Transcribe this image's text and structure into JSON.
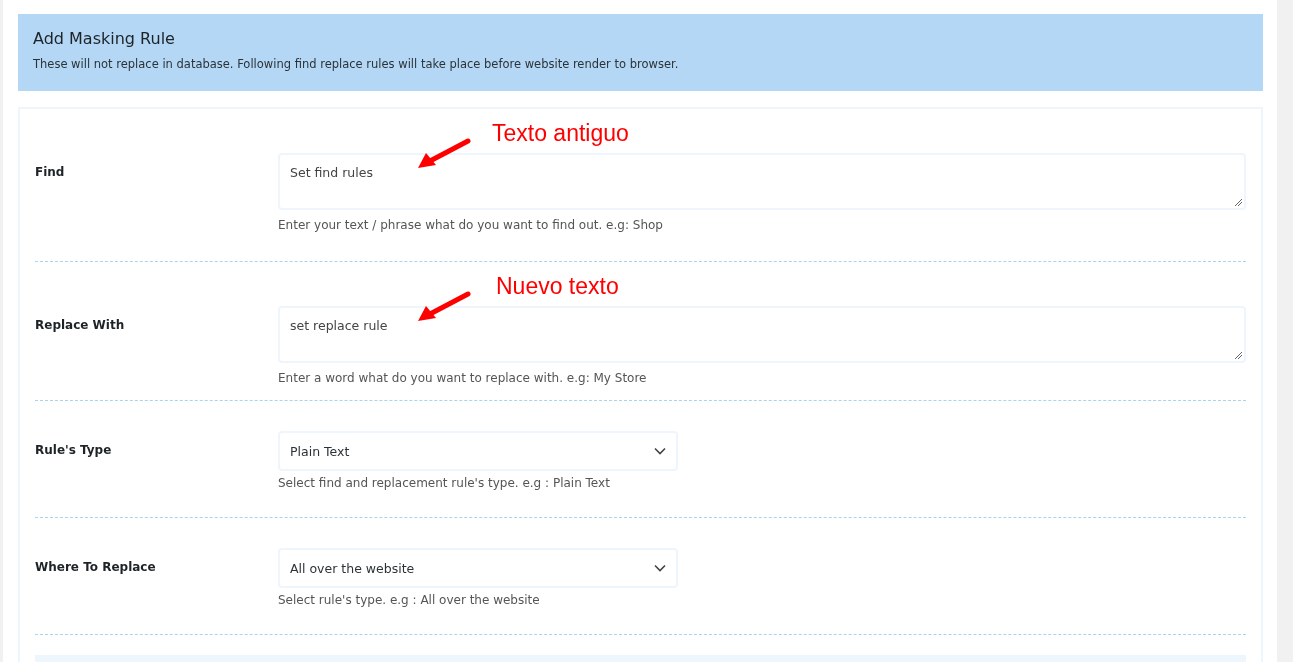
{
  "header": {
    "title": "Add Masking Rule",
    "description": "These will not replace in database. Following find replace rules will take place before website render to browser."
  },
  "rows": [
    {
      "kind": "textarea",
      "label": "Find",
      "value": "Set find rules",
      "hint": "Enter your text / phrase what do you want to find out. e.g: Shop",
      "annotation": "Texto antiguo"
    },
    {
      "kind": "textarea",
      "label": "Replace With",
      "value": "set replace rule",
      "hint": "Enter a word what do you want to replace with. e.g: My Store",
      "annotation": "Nuevo texto"
    },
    {
      "kind": "select",
      "label": "Rule's Type",
      "value": "Plain Text",
      "hint": "Select find and replacement rule's type. e.g : Plain Text"
    },
    {
      "kind": "select",
      "label": "Where To Replace",
      "value": "All over the website",
      "hint": "Select rule's type. e.g : All over the website"
    }
  ]
}
